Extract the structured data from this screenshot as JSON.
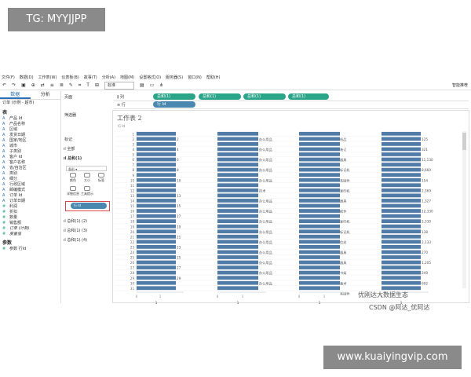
{
  "watermarks": {
    "top": "TG: MYYJJPP",
    "bottom": "www.kuaiyingvip.com"
  },
  "menu": [
    "文件(F)",
    "数据(D)",
    "工作表(W)",
    "仪表板(B)",
    "故事(T)",
    "分析(A)",
    "地图(M)",
    "设置格式(O)",
    "服务器(S)",
    "窗口(N)",
    "帮助(H)"
  ],
  "toolbar": {
    "view_select": "标准",
    "smart_label": "智能推荐"
  },
  "left": {
    "tabs": [
      "数据",
      "分析"
    ],
    "datasource": "订单 (示例 - 超市)",
    "dimensions_label": "表",
    "dimensions": [
      "产品 Id",
      "产品名称",
      "区域",
      "发货日期",
      "国家/地区",
      "城市",
      "子类别",
      "客户 Id",
      "客户名称",
      "省/自治区",
      "类别",
      "细分",
      "行政区域",
      "邮编模式",
      "订单 Id",
      "订单日期"
    ],
    "measures": [
      "利润",
      "折扣",
      "数量",
      "销售额",
      "订单 (计数)",
      "度量值"
    ],
    "params_label": "参数",
    "params": [
      "参数 行Id"
    ]
  },
  "mid": {
    "pages": "页面",
    "filters": "筛选器",
    "marks": "标记",
    "all": "全部",
    "total1": "总和(1)",
    "mark_type": "条形",
    "buttons": [
      "颜色",
      "大小",
      "标签",
      "详细信息",
      "工具提示"
    ],
    "pill": "行 Id",
    "total2": "总和(1) (2)",
    "total3": "总和(1) (3)",
    "total4": "总和(1) (4)"
  },
  "shelves": {
    "columns_label": "列",
    "rows_label": "行",
    "column_pills": [
      "总和(1)",
      "总和(1)",
      "总和(1)",
      "总和(1)"
    ],
    "row_pills": [
      "行 Id"
    ]
  },
  "sheet": {
    "title": "工作表 2",
    "row_header": "行 Id"
  },
  "chart_data": {
    "type": "table",
    "rows": [
      1,
      2,
      3,
      4,
      5,
      6,
      7,
      8,
      9,
      10,
      11,
      12,
      13,
      14,
      15,
      16,
      17,
      18,
      19,
      20,
      21,
      22,
      23,
      24,
      25,
      26,
      27,
      28,
      29,
      30,
      31
    ],
    "pane1_labels": [
      {
        "row": 2,
        "text": "2"
      },
      {
        "row": 4,
        "text": "4"
      },
      {
        "row": 6,
        "text": "6"
      },
      {
        "row": 8,
        "text": "8"
      },
      {
        "row": 10,
        "text": "10"
      },
      {
        "row": 13,
        "text": "13"
      },
      {
        "row": 15,
        "text": "15"
      },
      {
        "row": 17,
        "text": "17"
      },
      {
        "row": 19,
        "text": "19"
      },
      {
        "row": 21,
        "text": "21"
      },
      {
        "row": 23,
        "text": "23"
      },
      {
        "row": 25,
        "text": "25"
      },
      {
        "row": 27,
        "text": "27"
      },
      {
        "row": 29,
        "text": "29"
      }
    ],
    "pane2_labels": [
      {
        "row": 2,
        "text": "办公用品"
      },
      {
        "row": 4,
        "text": "办公用品"
      },
      {
        "row": 6,
        "text": "办公用品"
      },
      {
        "row": 8,
        "text": "办公用品"
      },
      {
        "row": 10,
        "text": "办公用品"
      },
      {
        "row": 12,
        "text": "技术"
      },
      {
        "row": 14,
        "text": "办公用品"
      },
      {
        "row": 16,
        "text": "办公用品"
      },
      {
        "row": 18,
        "text": "办公用品"
      },
      {
        "row": 20,
        "text": "办公用品"
      },
      {
        "row": 22,
        "text": "办公用品"
      },
      {
        "row": 24,
        "text": "办公用品"
      },
      {
        "row": 26,
        "text": "办公用品"
      },
      {
        "row": 28,
        "text": "办公用品"
      },
      {
        "row": 30,
        "text": "办公用品"
      }
    ],
    "pane3_labels": [
      {
        "row": 2,
        "text": "纸品"
      },
      {
        "row": 4,
        "text": "装订"
      },
      {
        "row": 6,
        "text": "器具"
      },
      {
        "row": 8,
        "text": "标记机"
      },
      {
        "row": 10,
        "text": "系固件"
      },
      {
        "row": 12,
        "text": "复印机"
      },
      {
        "row": 14,
        "text": "器具"
      },
      {
        "row": 16,
        "text": "配件"
      },
      {
        "row": 18,
        "text": "复印机"
      },
      {
        "row": 20,
        "text": "标记机"
      },
      {
        "row": 22,
        "text": "信封"
      },
      {
        "row": 24,
        "text": "器具"
      },
      {
        "row": 26,
        "text": "器具"
      },
      {
        "row": 28,
        "text": "书架"
      },
      {
        "row": 30,
        "text": "美术"
      },
      {
        "row": 32,
        "text": "系固件"
      }
    ],
    "pane4_labels": [
      {
        "row": 2,
        "text": "125"
      },
      {
        "row": 4,
        "text": "321"
      },
      {
        "row": 6,
        "text": "11,130"
      },
      {
        "row": 8,
        "text": "8,660"
      },
      {
        "row": 10,
        "text": "154"
      },
      {
        "row": 12,
        "text": "2,369"
      },
      {
        "row": 14,
        "text": "1,327"
      },
      {
        "row": 16,
        "text": "12,330"
      },
      {
        "row": 18,
        "text": "2,330"
      },
      {
        "row": 20,
        "text": "138"
      },
      {
        "row": 22,
        "text": "2,133"
      },
      {
        "row": 24,
        "text": "270"
      },
      {
        "row": 26,
        "text": "1,205"
      },
      {
        "row": 28,
        "text": "249"
      },
      {
        "row": 30,
        "text": "692"
      }
    ],
    "axis_ticks": [
      "0",
      "1"
    ],
    "axis_labels": [
      "1",
      "1",
      "1",
      "1"
    ],
    "bar_color": "#4f7ba6"
  },
  "credit": {
    "line1": "优刚达大数据生态",
    "line2": "CSDN @阿达_优阿达"
  }
}
